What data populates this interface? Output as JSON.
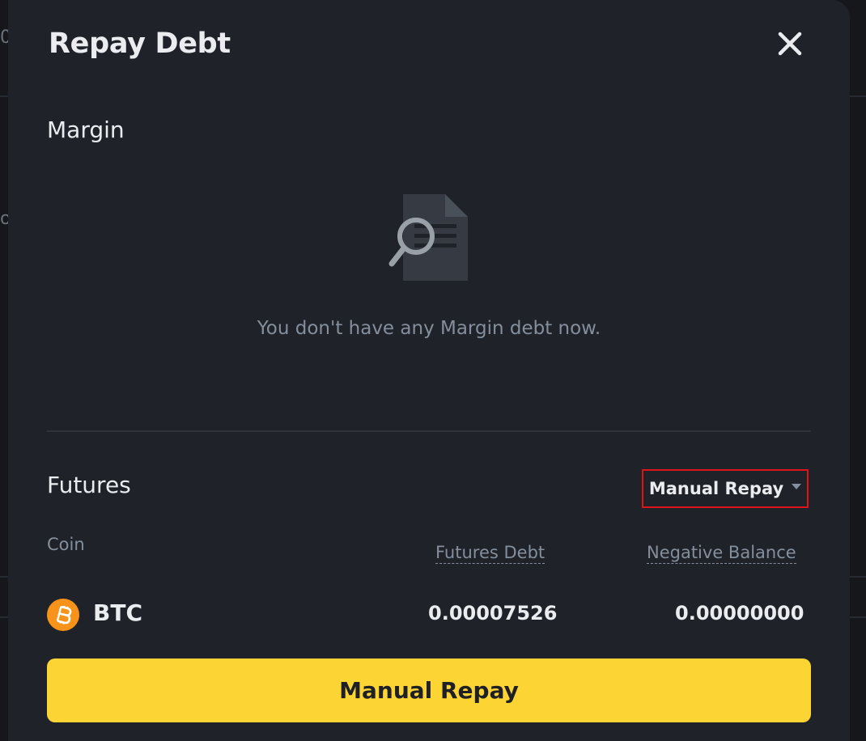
{
  "modal": {
    "title": "Repay Debt"
  },
  "margin": {
    "section_label": "Margin",
    "empty_message": "You don't have any Margin debt now.",
    "empty_icon": "document-search-icon"
  },
  "futures": {
    "section_label": "Futures",
    "mode_selector": {
      "selected": "Manual Repay",
      "icon": "caret-down-icon"
    },
    "table": {
      "columns": [
        "Coin",
        "Futures Debt",
        "Negative Balance"
      ],
      "rows": [
        {
          "coin": "BTC",
          "coin_icon": "bitcoin-icon",
          "futures_debt": "0.00007526",
          "negative_balance": "0.00000000"
        }
      ]
    }
  },
  "primary_action": {
    "label": "Manual Repay"
  },
  "colors": {
    "modal_bg": "#1f2329",
    "primary_button": "#fcd535",
    "bitcoin_orange": "#f7931a",
    "highlight_border": "#e0121a",
    "muted_text": "#848e9c"
  }
}
